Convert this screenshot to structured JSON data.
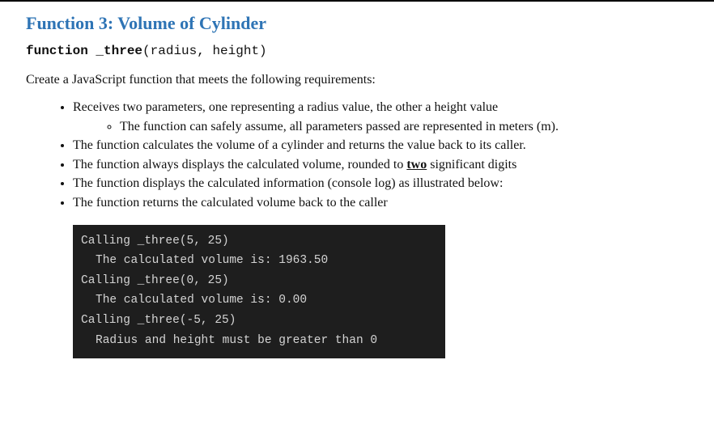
{
  "heading": "Function 3: Volume of Cylinder",
  "signature": {
    "bold1": "function",
    "space": " ",
    "bold2": "_three",
    "rest": "(radius, height)"
  },
  "intro": "Create a JavaScript function that meets the following requirements:",
  "bullets": {
    "b1": "Receives two parameters, one representing a radius value, the other a height value",
    "b1a": "The function can safely assume, all parameters passed are represented in meters (m).",
    "b2": "The function calculates the volume of a cylinder and returns the value back to its caller.",
    "b3_pre": "The function always displays the calculated volume, rounded to ",
    "b3_u": "two",
    "b3_post": " significant digits",
    "b4": "The function displays the calculated information (console log) as illustrated below:",
    "b5": "The function returns the calculated volume back to the caller"
  },
  "console": {
    "l1": "Calling _three(5, 25)",
    "l2": "The calculated volume is: 1963.50",
    "l3": "Calling _three(0, 25)",
    "l4": "The calculated volume is: 0.00",
    "l5": "Calling _three(-5, 25)",
    "l6": "Radius and height must be greater than 0"
  }
}
